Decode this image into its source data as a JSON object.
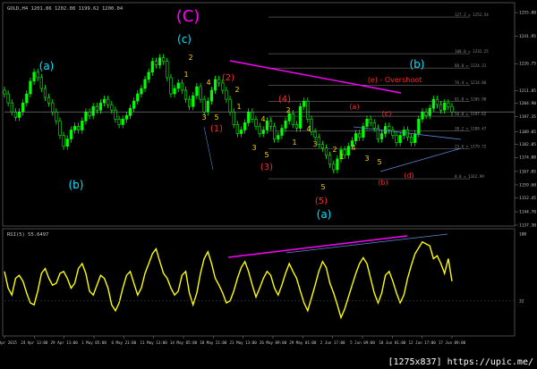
{
  "header": {
    "symbol_info": "GOLD,H4  1201.86 1202.08 1199.62 1200.04",
    "rsi_info": "RSI(5) 55.6497"
  },
  "watermark": "[1275x837] https://upic.me/",
  "colors": {
    "background": "#000000",
    "candle_up": "#00ff00",
    "candle_down": "#00ff00",
    "rsi_line": "#ffff00",
    "divergence": "#ff00ff",
    "trendline": "#5b8bd6",
    "fib": "#8a8a8a",
    "wave_major": "#ff00ff",
    "wave_intermediate": "#00e5ff",
    "wave_minor": "#ff2a2a",
    "wave_minute": "#ffd000"
  },
  "chart_data": [
    {
      "type": "line",
      "name": "price",
      "note": "main price panel (candles approximated by close path)",
      "ylim": [
        1137.3,
        1260.0
      ],
      "x_ticks": [
        "22 Apr 2015",
        "24 Apr 13:00",
        "29 Apr 13:00",
        "1 May 05:00",
        "6 May 21:00",
        "11 May 13:00",
        "14 May 05:00",
        "18 May 21:00",
        "21 May 13:00",
        "26 May 09:00",
        "29 May 01:00",
        "2 Jun 17:00",
        "5 Jun 09:00",
        "10 Jun 01:00",
        "12 Jun 17:00",
        "17 Jun 09:00"
      ],
      "y_ticks": [
        1255.0,
        1241.95,
        1226.75,
        1211.85,
        1204.9,
        1197.35,
        1189.05,
        1182.05,
        1174.8,
        1167.05,
        1159.6,
        1152.45,
        1144.7,
        1137.3
      ],
      "price_marker": 1200.04,
      "close": [
        1210,
        1205,
        1200,
        1197,
        1200,
        1205,
        1210,
        1217,
        1222,
        1219,
        1213,
        1208,
        1205,
        1200,
        1195,
        1187,
        1181,
        1185,
        1190,
        1192,
        1190,
        1195,
        1200,
        1198,
        1203,
        1201,
        1205,
        1207,
        1204,
        1201,
        1196,
        1193,
        1196,
        1198,
        1202,
        1206,
        1210,
        1213,
        1218,
        1222,
        1228,
        1226,
        1230,
        1228,
        1219,
        1210,
        1213,
        1216,
        1212,
        1207,
        1203,
        1209,
        1214,
        1207,
        1200,
        1206,
        1212,
        1218,
        1216,
        1212,
        1207,
        1200,
        1193,
        1188,
        1190,
        1194,
        1200,
        1196,
        1192,
        1188,
        1190,
        1195,
        1192,
        1185,
        1187,
        1191,
        1195,
        1199,
        1193,
        1191,
        1203,
        1206,
        1196,
        1189,
        1186,
        1182,
        1180,
        1176,
        1171,
        1168,
        1174,
        1179,
        1176,
        1181,
        1184,
        1188,
        1186,
        1192,
        1196,
        1194,
        1191,
        1185,
        1188,
        1192,
        1190,
        1187,
        1183,
        1187,
        1190,
        1186,
        1183,
        1188,
        1196,
        1200,
        1198,
        1202,
        1207,
        1204,
        1201,
        1205,
        1203,
        1200
      ],
      "fib_levels": [
        {
          "label": "127.2 = 1252.54",
          "value": 1252.54
        },
        {
          "label": "100.0 = 1232.25",
          "value": 1232.25
        },
        {
          "label": "88.8 = 1224.31",
          "value": 1224.31
        },
        {
          "label": "76.4 = 1214.86",
          "value": 1214.86
        },
        {
          "label": "61.8 = 1205.90",
          "value": 1205.9
        },
        {
          "label": "50.0 = 1197.62",
          "value": 1197.62
        },
        {
          "label": "38.2 = 1189.47",
          "value": 1189.47
        },
        {
          "label": "23.6 = 1179.72",
          "value": 1179.72
        },
        {
          "label": "0.0 = 1162.99",
          "value": 1162.99
        }
      ]
    },
    {
      "type": "line",
      "name": "RSI(5)",
      "ylim": [
        0,
        100
      ],
      "y_ticks": [
        100,
        32
      ],
      "values": [
        62,
        45,
        38,
        55,
        58,
        52,
        40,
        30,
        28,
        42,
        60,
        65,
        55,
        48,
        50,
        60,
        62,
        55,
        45,
        50,
        65,
        70,
        60,
        42,
        38,
        48,
        58,
        55,
        45,
        28,
        22,
        30,
        45,
        58,
        62,
        50,
        38,
        45,
        60,
        70,
        80,
        85,
        72,
        60,
        55,
        45,
        38,
        42,
        58,
        62,
        40,
        28,
        40,
        60,
        75,
        82,
        70,
        55,
        48,
        40,
        30,
        32,
        42,
        55,
        66,
        72,
        62,
        48,
        36,
        45,
        55,
        62,
        58,
        45,
        38,
        48,
        60,
        70,
        62,
        55,
        42,
        30,
        22,
        35,
        48,
        62,
        72,
        66,
        50,
        40,
        28,
        15,
        24,
        36,
        48,
        60,
        70,
        76,
        70,
        55,
        40,
        30,
        40,
        58,
        62,
        52,
        40,
        30,
        38,
        55,
        68,
        80,
        86,
        92,
        90,
        88,
        75,
        78,
        70,
        60,
        75,
        52
      ]
    }
  ],
  "annotations": {
    "wave_labels": [
      {
        "text": "(C)",
        "color": "wave_major"
      },
      {
        "text": "(c)",
        "color": "wave_intermediate"
      },
      {
        "text": "(a)",
        "color": "wave_intermediate"
      },
      {
        "text": "(b)",
        "color": "wave_intermediate"
      },
      {
        "text": "(b)",
        "color": "wave_intermediate"
      },
      {
        "text": "(a)",
        "color": "wave_intermediate"
      },
      {
        "text": "(2)",
        "color": "wave_minor"
      },
      {
        "text": "(1)",
        "color": "wave_minor"
      },
      {
        "text": "(4)",
        "color": "wave_minor"
      },
      {
        "text": "(3)",
        "color": "wave_minor"
      },
      {
        "text": "(5)",
        "color": "wave_minor"
      },
      {
        "text": "(a)",
        "color": "wave_minor"
      },
      {
        "text": "(c)",
        "color": "wave_minor"
      },
      {
        "text": "(b)",
        "color": "wave_minor"
      },
      {
        "text": "(d)",
        "color": "wave_minor"
      },
      {
        "text": "(e) -  Overshoot",
        "color": "wave_minor"
      }
    ],
    "minute_labels": [
      "2",
      "1",
      "4",
      "3",
      "5",
      "2",
      "1",
      "4",
      "3",
      "5",
      "2",
      "1",
      "4",
      "3",
      "5",
      "2",
      "1",
      "4",
      "3",
      "5"
    ]
  }
}
